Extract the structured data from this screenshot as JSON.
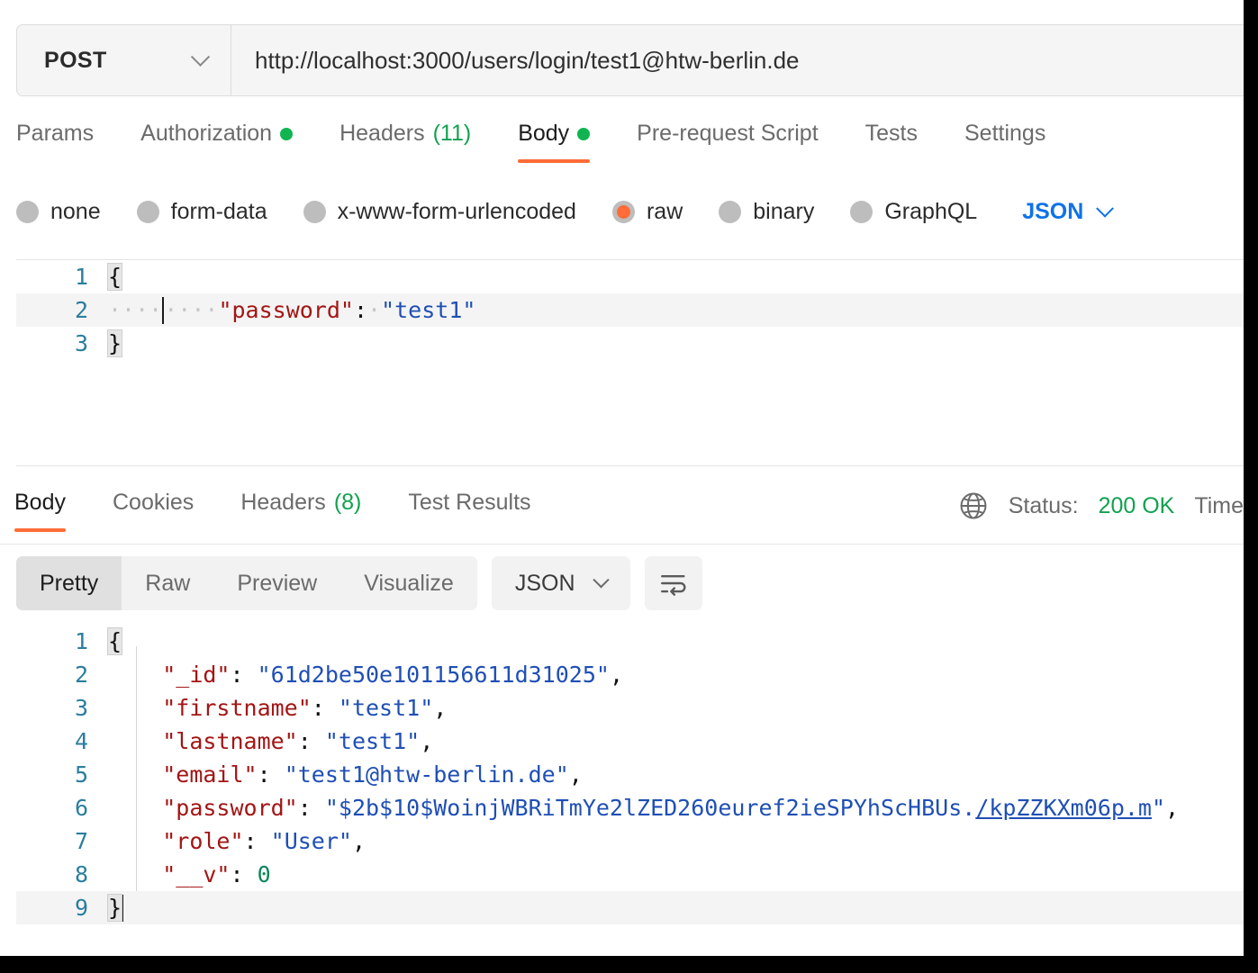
{
  "request": {
    "method": "POST",
    "method_dropdown_icon": "chevron-down-icon",
    "url": "http://localhost:3000/users/login/test1@htw-berlin.de",
    "tabs": [
      {
        "label": "Params",
        "badge": "",
        "dot": false,
        "active": false
      },
      {
        "label": "Authorization",
        "badge": "",
        "dot": true,
        "active": false
      },
      {
        "label": "Headers",
        "badge": "(11)",
        "dot": false,
        "active": false
      },
      {
        "label": "Body",
        "badge": "",
        "dot": true,
        "active": true
      },
      {
        "label": "Pre-request Script",
        "badge": "",
        "dot": false,
        "active": false
      },
      {
        "label": "Tests",
        "badge": "",
        "dot": false,
        "active": false
      },
      {
        "label": "Settings",
        "badge": "",
        "dot": false,
        "active": false
      }
    ],
    "body_types": [
      {
        "label": "none",
        "selected": false
      },
      {
        "label": "form-data",
        "selected": false
      },
      {
        "label": "x-www-form-urlencoded",
        "selected": false
      },
      {
        "label": "raw",
        "selected": true
      },
      {
        "label": "binary",
        "selected": false
      },
      {
        "label": "GraphQL",
        "selected": false
      }
    ],
    "raw_format": "JSON",
    "raw_format_icon": "chevron-down-icon",
    "code_lines": [
      {
        "num": "1"
      },
      {
        "num": "2"
      },
      {
        "num": "3"
      }
    ],
    "body_line1_brace": "{",
    "body_line2_ws1": "····",
    "body_line2_ws2": "····",
    "body_line2_key": "\"password\"",
    "body_line2_colon": ":",
    "body_line2_space": "·",
    "body_line2_value": "\"test1\"",
    "body_line3_brace": "}"
  },
  "response": {
    "tabs": [
      {
        "label": "Body",
        "badge": "",
        "active": true
      },
      {
        "label": "Cookies",
        "badge": "",
        "active": false
      },
      {
        "label": "Headers",
        "badge": "(8)",
        "active": false
      },
      {
        "label": "Test Results",
        "badge": "",
        "active": false
      }
    ],
    "globe_icon": "globe-icon",
    "status_label": "Status:",
    "status_value": "200 OK",
    "time_label": "Time",
    "view_modes": [
      {
        "label": "Pretty",
        "active": true
      },
      {
        "label": "Raw",
        "active": false
      },
      {
        "label": "Preview",
        "active": false
      },
      {
        "label": "Visualize",
        "active": false
      }
    ],
    "format": "JSON",
    "format_icon": "chevron-down-icon",
    "wrap_icon": "word-wrap-icon",
    "code_lines": [
      {
        "num": "1"
      },
      {
        "num": "2"
      },
      {
        "num": "3"
      },
      {
        "num": "4"
      },
      {
        "num": "5"
      },
      {
        "num": "6"
      },
      {
        "num": "7"
      },
      {
        "num": "8"
      },
      {
        "num": "9"
      }
    ],
    "json": {
      "open_brace": "{",
      "close_brace": "}",
      "indent": "    ",
      "rows": [
        {
          "key": "\"_id\"",
          "value": "\"61d2be50e101156611d31025\"",
          "comma": ",",
          "type": "string"
        },
        {
          "key": "\"firstname\"",
          "value": "\"test1\"",
          "comma": ",",
          "type": "string"
        },
        {
          "key": "\"lastname\"",
          "value": "\"test1\"",
          "comma": ",",
          "type": "string"
        },
        {
          "key": "\"email\"",
          "value": "\"test1@htw-berlin.de\"",
          "comma": ",",
          "type": "string"
        },
        {
          "key": "\"password\"",
          "value": "\"$2b$10$WoinjWBRiTmYe2lZED260euref2ieSPYhScHBUs./kpZZKXm06p.m\"",
          "comma": ",",
          "type": "string"
        },
        {
          "key": "\"role\"",
          "value": "\"User\"",
          "comma": ",",
          "type": "string"
        },
        {
          "key": "\"__v\"",
          "value": "0",
          "comma": "",
          "type": "number"
        }
      ],
      "password_plain": "\"$2b$10$WoinjWBRiTmYe2lZED260euref2ieSPYhScHBUs.",
      "password_link": "/kpZZKXm06p.m",
      "password_tail": "\""
    }
  },
  "colors": {
    "accent": "#ff6c37",
    "success": "#12a150",
    "link": "#0f72e8",
    "json_key": "#a31515",
    "json_string": "#1f4fb5",
    "json_number": "#098658",
    "gutter": "#2b7e9e"
  }
}
